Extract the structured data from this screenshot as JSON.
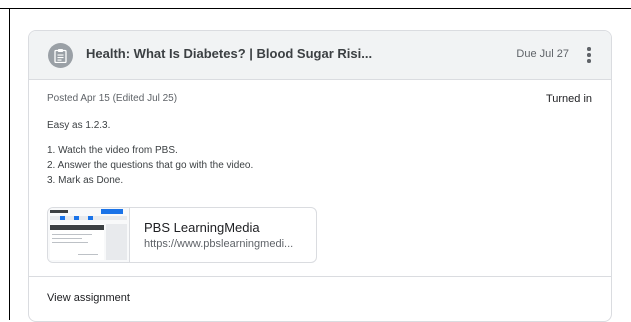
{
  "assignment": {
    "title": "Health: What Is Diabetes? | Blood Sugar Risi...",
    "due": "Due Jul 27",
    "posted": "Posted Apr 15 (Edited Jul 25)",
    "status": "Turned in",
    "description": {
      "intro": "Easy as 1.2.3.",
      "steps": [
        "1. Watch the video from PBS.",
        "2. Answer the questions that go with the video.",
        "3. Mark as Done."
      ]
    },
    "attachment": {
      "title": "PBS LearningMedia",
      "url": "https://www.pbslearningmedi..."
    },
    "view_label": "View assignment"
  },
  "icons": {
    "assignment": "assignment-icon",
    "more": "more-vert-icon"
  }
}
